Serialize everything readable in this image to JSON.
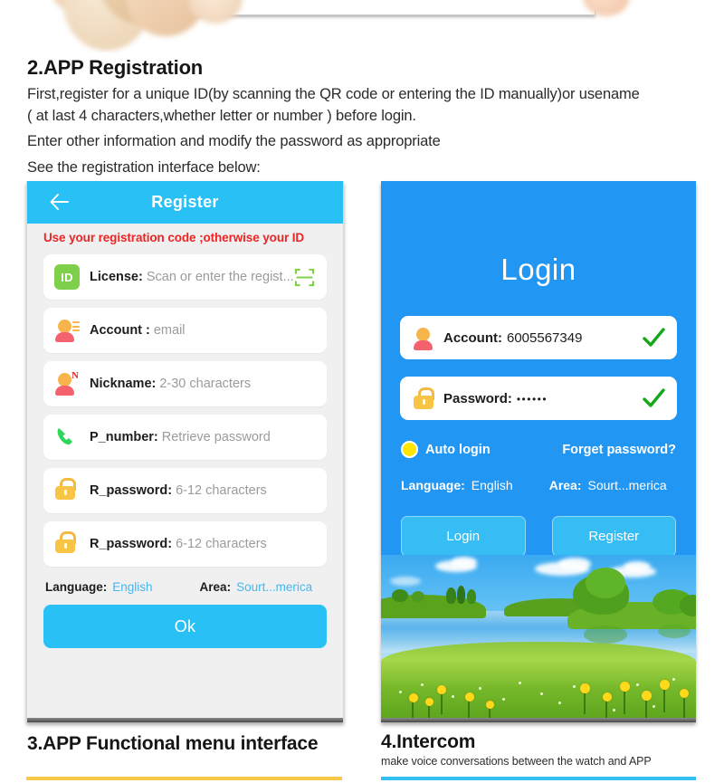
{
  "section2": {
    "heading": "2.APP Registration",
    "lines": [
      "First,register for a unique ID(by scanning the QR code or entering the ID manually)or usename",
      "( at last 4 characters,whether letter or number ) before login.",
      "Enter other information and modify the password as appropriate",
      "See the registration interface below:"
    ]
  },
  "register_screen": {
    "title": "Register",
    "back_icon": "back-arrow-icon",
    "warning": "Use your registration code ;otherwise your ID",
    "fields": [
      {
        "icon": "id-badge-icon",
        "badge_text": "ID",
        "label": "License:",
        "placeholder": "Scan or enter the regist...",
        "trailing_icon": "qr-scan-icon"
      },
      {
        "icon": "account-avatar-icon",
        "label": "Account :",
        "placeholder": "email"
      },
      {
        "icon": "nickname-avatar-icon",
        "badge_text": "N",
        "label": "Nickname:",
        "placeholder": "2-30 characters"
      },
      {
        "icon": "phone-icon",
        "label": "P_number:",
        "placeholder": "Retrieve password"
      },
      {
        "icon": "lock-icon",
        "label": "R_password:",
        "placeholder": "6-12 characters"
      },
      {
        "icon": "lock-icon",
        "label": "R_password:",
        "placeholder": "6-12 characters"
      }
    ],
    "language_label": "Language:",
    "language_value": "English",
    "area_label": "Area:",
    "area_value": "Sourt...merica",
    "ok_button": "Ok",
    "colors": {
      "titlebar": "#29c0f5",
      "warning": "#ee2424",
      "link": "#46b6ef",
      "ok": "#29c0f5"
    }
  },
  "login_screen": {
    "title": "Login",
    "fields": [
      {
        "icon": "account-avatar-icon",
        "label": "Account:",
        "value": "6005567349",
        "trailing_icon": "check-icon"
      },
      {
        "icon": "lock-icon",
        "label": "Password:",
        "value": "••••••",
        "trailing_icon": "check-icon"
      }
    ],
    "auto_login_label": "Auto login",
    "auto_login_checked": true,
    "forget_password": "Forget password?",
    "language_label": "Language:",
    "language_value": "English",
    "area_label": "Area:",
    "area_value": "Sourt...merica",
    "login_button": "Login",
    "register_button": "Register",
    "colors": {
      "background": "#2196f3",
      "button": "#35bdf4",
      "radio": "#ffe600",
      "check": "#17a81a"
    }
  },
  "section3": {
    "heading": "3.APP Functional menu interface",
    "bar_color": "#f7c948"
  },
  "section4": {
    "heading": "4.Intercom",
    "subtitle": "make voice conversations between the watch and APP",
    "bar_color": "#33bdf0"
  }
}
